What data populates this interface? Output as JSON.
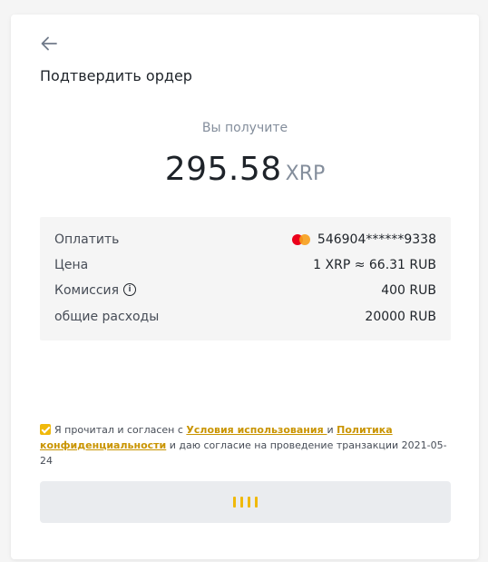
{
  "header": {
    "title": "Подтвердить ордер"
  },
  "receive": {
    "label": "Вы получите",
    "amount": "295.58",
    "unit": "XRP"
  },
  "details": {
    "pay_label": "Оплатить",
    "pay_value": "546904******9338",
    "price_label": "Цена",
    "price_value": "1 XRP ≈ 66.31 RUB",
    "fee_label": "Комиссия",
    "fee_value": "400 RUB",
    "total_label": "общие расходы",
    "total_value": "20000 RUB"
  },
  "agreement": {
    "checked": true,
    "text_before": "Я прочитал и согласен с ",
    "terms_link": "Условия использования ",
    "and": " и ",
    "privacy_link": "Политика конфиденциальности",
    "text_after": " и даю согласие на проведение транзакции 2021-05-24"
  },
  "icons": {
    "back": "arrow-left-icon",
    "card": "mastercard-icon",
    "info": "info-icon",
    "loader": "loading-icon"
  },
  "colors": {
    "accent": "#f0b90b",
    "link": "#c99400",
    "button_bg": "#eaecef"
  }
}
